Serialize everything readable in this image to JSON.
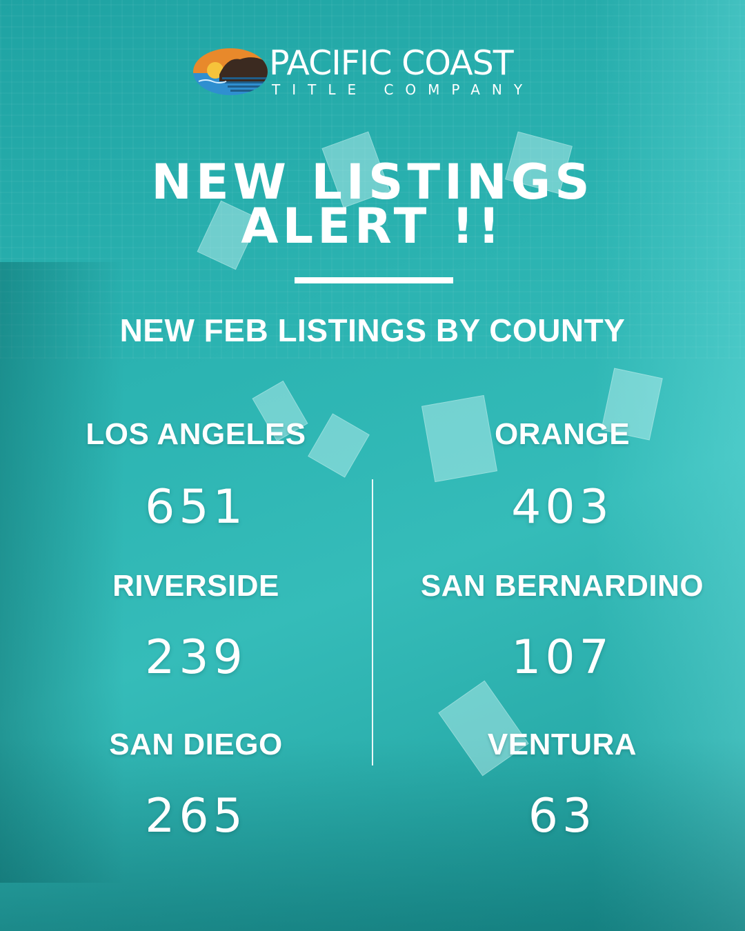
{
  "brand": {
    "name": "PACIFIC COAST",
    "tagline": "TITLE COMPANY"
  },
  "headline": {
    "line1": "NEW LISTINGS",
    "line2": "ALERT !!"
  },
  "subheading": "NEW FEB LISTINGS BY COUNTY",
  "counties": [
    {
      "name": "LOS ANGELES",
      "value": "651"
    },
    {
      "name": "ORANGE",
      "value": "403"
    },
    {
      "name": "RIVERSIDE",
      "value": "239"
    },
    {
      "name": "SAN BERNARDINO",
      "value": "107"
    },
    {
      "name": "SAN DIEGO",
      "value": "265"
    },
    {
      "name": "VENTURA",
      "value": "63"
    }
  ],
  "colors": {
    "background": "#2bb3b1",
    "text": "#ffffff",
    "logo_orange": "#e8892b",
    "logo_blue": "#2f8fd0",
    "logo_dark": "#3b2a20"
  },
  "icons": {
    "logo_mark": "sunset-coast-logo-icon"
  }
}
